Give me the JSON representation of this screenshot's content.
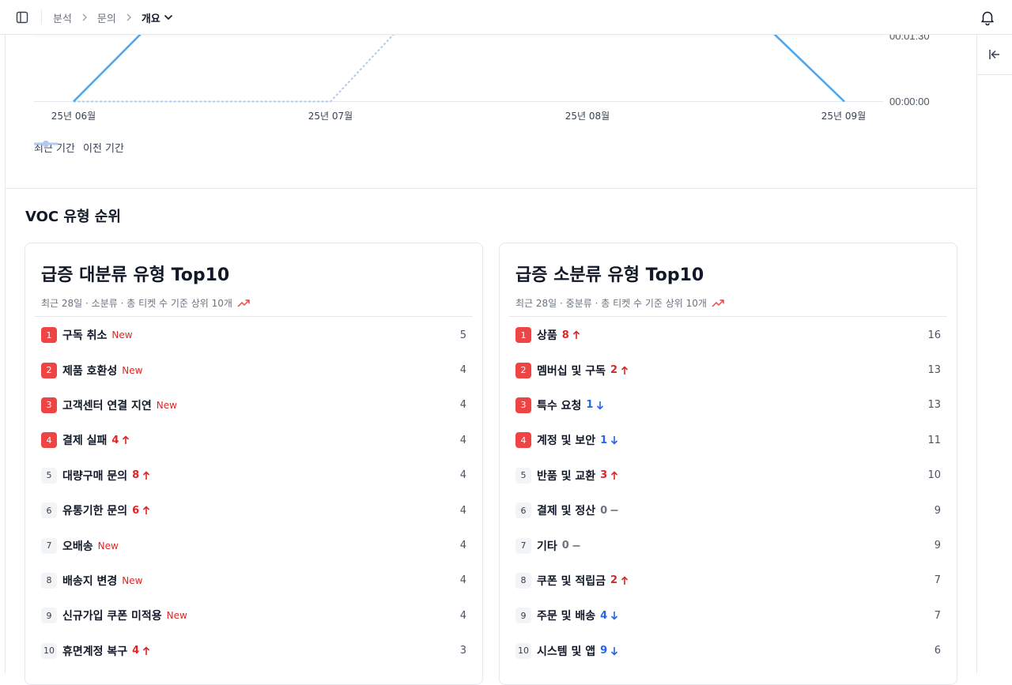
{
  "header": {
    "breadcrumbs": [
      "분석",
      "문의"
    ],
    "current": "개요"
  },
  "chart_data": {
    "type": "line",
    "x": [
      "25년 06월",
      "25년 07월",
      "25년 08월",
      "25년 09월"
    ],
    "y_ticks": [
      "00:00:00",
      "00:01:30"
    ],
    "series": [
      {
        "name": "최근 기간",
        "color": "#4ea7ee"
      },
      {
        "name": "이전 기간",
        "color": "#b4c8f0"
      }
    ]
  },
  "section": {
    "title": "VOC 유형 순위"
  },
  "cards": [
    {
      "title": "급증 대분류 유형 Top10",
      "subtitle": "최근 28일 · 소분류 · 총 티켓 수 기준 상위 10개",
      "items": [
        {
          "rank": "1",
          "label": "구독 취소",
          "badge": "New",
          "change": "",
          "dir": "",
          "value": "5"
        },
        {
          "rank": "2",
          "label": "제품 호환성",
          "badge": "New",
          "change": "",
          "dir": "",
          "value": "4"
        },
        {
          "rank": "3",
          "label": "고객센터 연결 지연",
          "badge": "New",
          "change": "",
          "dir": "",
          "value": "4"
        },
        {
          "rank": "4",
          "label": "결제 실패",
          "badge": "",
          "change": "4",
          "dir": "up",
          "value": "4"
        },
        {
          "rank": "5",
          "label": "대량구매 문의",
          "badge": "",
          "change": "8",
          "dir": "up",
          "value": "4"
        },
        {
          "rank": "6",
          "label": "유통기한 문의",
          "badge": "",
          "change": "6",
          "dir": "up",
          "value": "4"
        },
        {
          "rank": "7",
          "label": "오배송",
          "badge": "New",
          "change": "",
          "dir": "",
          "value": "4"
        },
        {
          "rank": "8",
          "label": "배송지 변경",
          "badge": "New",
          "change": "",
          "dir": "",
          "value": "4"
        },
        {
          "rank": "9",
          "label": "신규가입 쿠폰 미적용",
          "badge": "New",
          "change": "",
          "dir": "",
          "value": "4"
        },
        {
          "rank": "10",
          "label": "휴면계정 복구",
          "badge": "",
          "change": "4",
          "dir": "up",
          "value": "3"
        }
      ]
    },
    {
      "title": "급증 소분류 유형 Top10",
      "subtitle": "최근 28일 · 중분류 · 총 티켓 수 기준 상위 10개",
      "items": [
        {
          "rank": "1",
          "label": "상품",
          "badge": "",
          "change": "8",
          "dir": "up",
          "value": "16"
        },
        {
          "rank": "2",
          "label": "멤버십 및 구독",
          "badge": "",
          "change": "2",
          "dir": "up",
          "value": "13"
        },
        {
          "rank": "3",
          "label": "특수 요청",
          "badge": "",
          "change": "1",
          "dir": "down",
          "value": "13"
        },
        {
          "rank": "4",
          "label": "계정 및 보안",
          "badge": "",
          "change": "1",
          "dir": "down",
          "value": "11"
        },
        {
          "rank": "5",
          "label": "반품 및 교환",
          "badge": "",
          "change": "3",
          "dir": "up",
          "value": "10"
        },
        {
          "rank": "6",
          "label": "결제 및 정산",
          "badge": "",
          "change": "0",
          "dir": "same",
          "value": "9"
        },
        {
          "rank": "7",
          "label": "기타",
          "badge": "",
          "change": "0",
          "dir": "same",
          "value": "9"
        },
        {
          "rank": "8",
          "label": "쿠폰 및 적립금",
          "badge": "",
          "change": "2",
          "dir": "up",
          "value": "7"
        },
        {
          "rank": "9",
          "label": "주문 및 배송",
          "badge": "",
          "change": "4",
          "dir": "down",
          "value": "7"
        },
        {
          "rank": "10",
          "label": "시스템 및 앱",
          "badge": "",
          "change": "9",
          "dir": "down",
          "value": "6"
        }
      ]
    }
  ]
}
